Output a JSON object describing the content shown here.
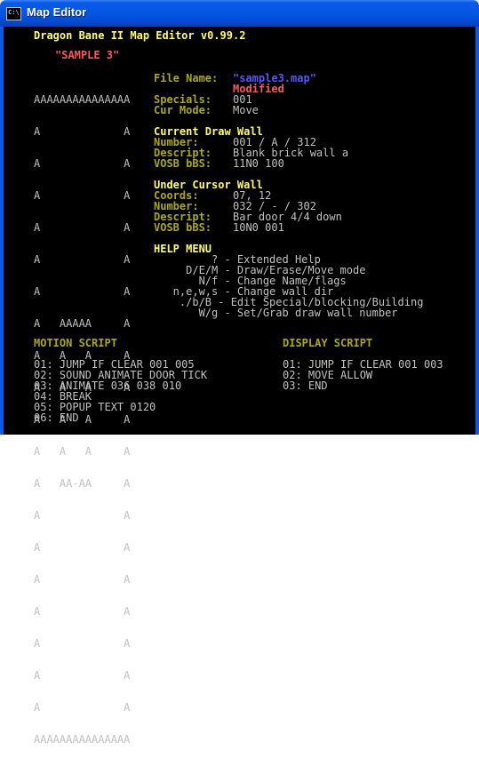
{
  "window": {
    "title": "Map Editor",
    "icon": "console-icon"
  },
  "header": {
    "app_title": "Dragon Bane II Map Editor v0.99.2",
    "map_name": "\"SAMPLE 3\""
  },
  "map_grid": [
    "AAAAAAAAAAAAAAA",
    "A             A",
    "A             A",
    "A             A",
    "A             A",
    "A             A",
    "A             A",
    "A   AAAAA     A",
    "A   A   A     A",
    "A   A   A     A",
    "A   A   A     A",
    "A   A   A     A",
    "A   AA-AA     A",
    "A             A",
    "A             A",
    "A             A",
    "A             A",
    "A             A",
    "A             A",
    "A             A",
    "AAAAAAAAAAAAAAA"
  ],
  "info": {
    "file_label": "File Name:",
    "file_value": "\"sample3.map\"",
    "modified": "Modified",
    "specials_label": "Specials:",
    "specials_value": "001",
    "curmode_label": "Cur Mode:",
    "curmode_value": "Move"
  },
  "current_wall": {
    "heading": "Current Draw Wall",
    "number_label": "Number:",
    "number_value": "001 / A / 312",
    "descript_label": "Descript:",
    "descript_value": "Blank brick wall a",
    "vosb_label": "VOSB bBS:",
    "vosb_value": "11N0 100"
  },
  "cursor_wall": {
    "heading": "Under Cursor Wall",
    "coords_label": "Coords:",
    "coords_value": "07, 12",
    "number_label": "Number:",
    "number_value": "032 / - / 302",
    "descript_label": "Descript:",
    "descript_value": "Bar door 4/4 down",
    "vosb_label": "VOSB bBS:",
    "vosb_value": "10N0 001"
  },
  "help": {
    "heading": "HELP MENU",
    "lines": [
      "         ? - Extended Help",
      "     D/E/M - Draw/Erase/Move mode",
      "       N/f - Change Name/flags",
      "   n,e,w,s - Change wall dir",
      "    ./b/B - Edit Special/blocking/Building",
      "       W/g - Set/Grab draw wall number"
    ]
  },
  "motion_script": {
    "heading": "MOTION SCRIPT",
    "lines": [
      "01: JUMP IF CLEAR 001 005",
      "02: SOUND ANIMATE DOOR TICK",
      "03: ANIMATE 036 038 010",
      "04: BREAK",
      "05: POPUP TEXT 0120",
      "06: END"
    ]
  },
  "display_script": {
    "heading": "DISPLAY SCRIPT",
    "lines": [
      "01: JUMP IF CLEAR 001 003",
      "02: MOVE ALLOW",
      "03: END"
    ]
  }
}
